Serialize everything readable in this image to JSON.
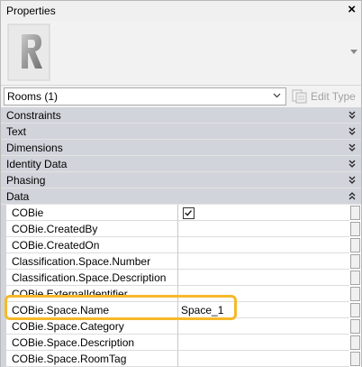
{
  "panel": {
    "title": "Properties",
    "close_glyph": "×"
  },
  "preview": {
    "logo_icon": "revit-r-logo-icon",
    "scroll_icon": "chevron-down-icon"
  },
  "type_selector": {
    "value": "Rooms (1)",
    "edit_type_label": "Edit Type"
  },
  "categories": [
    {
      "label": "Constraints",
      "state": "collapsed"
    },
    {
      "label": "Text",
      "state": "collapsed"
    },
    {
      "label": "Dimensions",
      "state": "collapsed"
    },
    {
      "label": "Identity Data",
      "state": "collapsed"
    },
    {
      "label": "Phasing",
      "state": "collapsed"
    },
    {
      "label": "Data",
      "state": "expanded"
    }
  ],
  "data_rows": [
    {
      "name": "COBie",
      "value": "",
      "checked": true
    },
    {
      "name": "COBie.CreatedBy",
      "value": ""
    },
    {
      "name": "COBie.CreatedOn",
      "value": ""
    },
    {
      "name": "Classification.Space.Number",
      "value": ""
    },
    {
      "name": "Classification.Space.Description",
      "value": ""
    },
    {
      "name": "COBie.ExternalIdentifier",
      "value": ""
    },
    {
      "name": "COBie.Space.Name",
      "value": "Space_1",
      "highlighted": true
    },
    {
      "name": "COBie.Space.Category",
      "value": ""
    },
    {
      "name": "COBie.Space.Description",
      "value": ""
    },
    {
      "name": "COBie.Space.RoomTag",
      "value": ""
    }
  ],
  "colors": {
    "category_band": "#d2d4db",
    "highlight": "#f6b92a"
  }
}
